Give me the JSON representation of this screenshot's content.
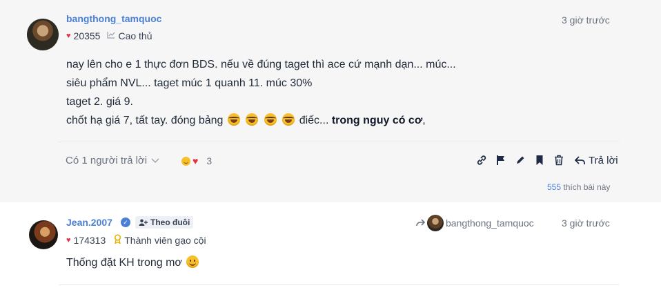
{
  "post1": {
    "username": "bangthong_tamquoc",
    "reputation": "20355",
    "rank": "Cao thủ",
    "time": "3 giờ trước",
    "lines": [
      "nay lên cho e 1 thực đơn BDS. nếu về đúng taget thì ace cứ mạnh dạn... múc...",
      "siêu phẩm NVL... taget múc 1 quanh 11. múc 30%",
      "taget 2. giá 9."
    ],
    "last_line_start": "chốt hạ giá 7, tất tay. đóng bảng",
    "last_line_mid": " điếc... ",
    "last_line_bold": "trong nguy có cơ",
    "last_line_end": ",",
    "replies_label": "Có 1 người trả lời",
    "reaction_count": "3",
    "reply_label": "Trả lời",
    "likes_count": "555",
    "likes_label": " thích bài này"
  },
  "post2": {
    "username": "Jean.2007",
    "follow_label": "Theo đuôi",
    "reputation": "174313",
    "rank": "Thành viên gạo cội",
    "quoted_user": "bangthong_tamquoc",
    "time": "3 giờ trước",
    "content": "Thống đặt KH trong mơ"
  },
  "colors": {
    "accent": "#4a7fd4",
    "heart": "#e03546",
    "post_bg": "#f6f6f7"
  }
}
